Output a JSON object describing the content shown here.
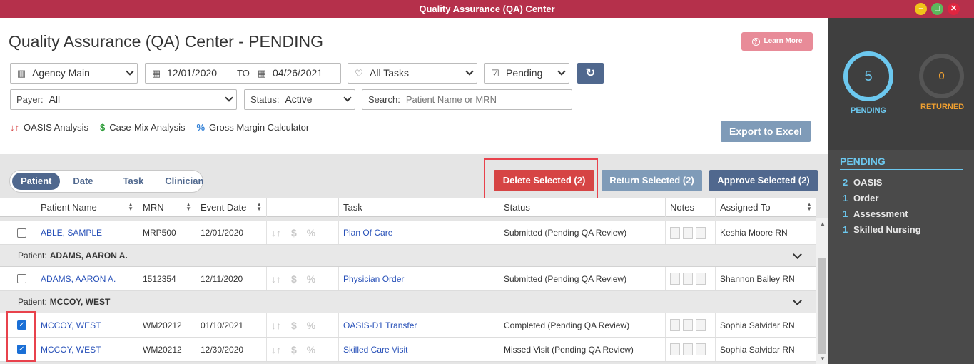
{
  "window": {
    "title": "Quality Assurance (QA) Center"
  },
  "page": {
    "title": "Quality Assurance (QA) Center - PENDING",
    "learn_more": "Learn More"
  },
  "filters": {
    "agency": "Agency Main",
    "date_from": "12/01/2020",
    "date_to_label": "TO",
    "date_to": "04/26/2021",
    "tasks": "All Tasks",
    "status_filter": "Pending",
    "payer_label": "Payer:",
    "payer": "All",
    "status_label": "Status:",
    "status": "Active",
    "search_label": "Search:",
    "search_placeholder": "Patient Name or MRN"
  },
  "tools": {
    "oasis": "OASIS Analysis",
    "casemix": "Case-Mix Analysis",
    "margin": "Gross Margin Calculator"
  },
  "export_label": "Export to Excel",
  "tabs": [
    "Patient",
    "Date",
    "Task",
    "Clinician"
  ],
  "actions": {
    "delete": "Delete Selected (2)",
    "return": "Return Selected (2)",
    "approve": "Approve Selected (2)"
  },
  "columns": {
    "patient_name": "Patient Name",
    "mrn": "MRN",
    "event_date": "Event Date",
    "task": "Task",
    "status": "Status",
    "notes": "Notes",
    "assigned_to": "Assigned To"
  },
  "groups": [
    {
      "label": "Patient:",
      "name": "ADAMS, AARON A."
    },
    {
      "label": "Patient:",
      "name": "MCCOY, WEST"
    }
  ],
  "rows": [
    {
      "name": "ABLE, SAMPLE",
      "mrn": "MRP500",
      "date": "12/01/2020",
      "task": "Plan Of Care",
      "status": "Submitted (Pending QA Review)",
      "assigned": "Keshia Moore RN",
      "checked": false
    },
    {
      "name": "ADAMS, AARON A.",
      "mrn": "1512354",
      "date": "12/11/2020",
      "task": "Physician Order",
      "status": "Submitted (Pending QA Review)",
      "assigned": "Shannon Bailey RN",
      "checked": false
    },
    {
      "name": "MCCOY, WEST",
      "mrn": "WM20212",
      "date": "01/10/2021",
      "task": "OASIS-D1 Transfer",
      "status": "Completed (Pending QA Review)",
      "assigned": "Sophia Salvidar RN",
      "checked": true
    },
    {
      "name": "MCCOY, WEST",
      "mrn": "WM20212",
      "date": "12/30/2020",
      "task": "Skilled Care Visit",
      "status": "Missed Visit (Pending QA Review)",
      "assigned": "Sophia Salvidar RN",
      "checked": true
    }
  ],
  "summary": {
    "pending_count": "5",
    "pending_label": "PENDING",
    "returned_count": "0",
    "returned_label": "RETURNED",
    "list_title": "PENDING",
    "items": [
      {
        "count": "2",
        "label": "OASIS"
      },
      {
        "count": "1",
        "label": "Order"
      },
      {
        "count": "1",
        "label": "Assessment"
      },
      {
        "count": "1",
        "label": "Skilled Nursing"
      }
    ]
  },
  "colors": {
    "titlebar": "#b5304b",
    "primary": "#50688e",
    "delete": "#d64444",
    "pending": "#6cc8ef",
    "returned": "#f0a030"
  }
}
